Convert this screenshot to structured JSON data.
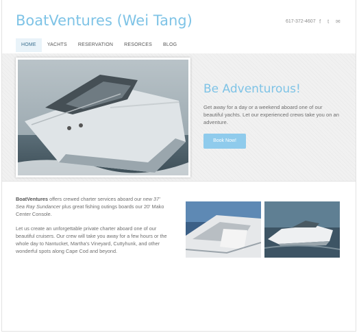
{
  "header": {
    "site_title": "BoatVentures (Wei Tang)",
    "phone": "617-372-4607",
    "social": [
      {
        "icon": "facebook-icon",
        "glyph": "f"
      },
      {
        "icon": "twitter-icon",
        "glyph": "t"
      },
      {
        "icon": "email-icon",
        "glyph": "✉"
      }
    ]
  },
  "nav": {
    "items": [
      "HOME",
      "YACHTS",
      "RESERVATION",
      "RESORCES",
      "BLOG"
    ],
    "active": "HOME"
  },
  "hero": {
    "heading": "Be Adventurous!",
    "text": "Get away for a day or a weekend aboard one of our beautiful yachts. Let our experienced crews take you on an adventure.",
    "button_label": "Book Now!"
  },
  "content": {
    "brand": "BoatVentures",
    "p1_a": " offers crewed charter services aboard our ",
    "p1_italic": "new 37' Sea Ray Sundancer",
    "p1_b": " plus great fishing outings boards our 20' Mako Center Console.",
    "p2": "Let us create an unforgettable private charter aboard one of our beautiful cruisers. Our crew will take you away for a few hours or the whole day to Nantucket, Martha's Vineyard, Cuttyhunk, and other wonderful spots along Cape Cod and beyond."
  },
  "colors": {
    "accent": "#7ec3e6",
    "button": "#8fcbec",
    "nav_active_bg": "#e9f3f9"
  }
}
